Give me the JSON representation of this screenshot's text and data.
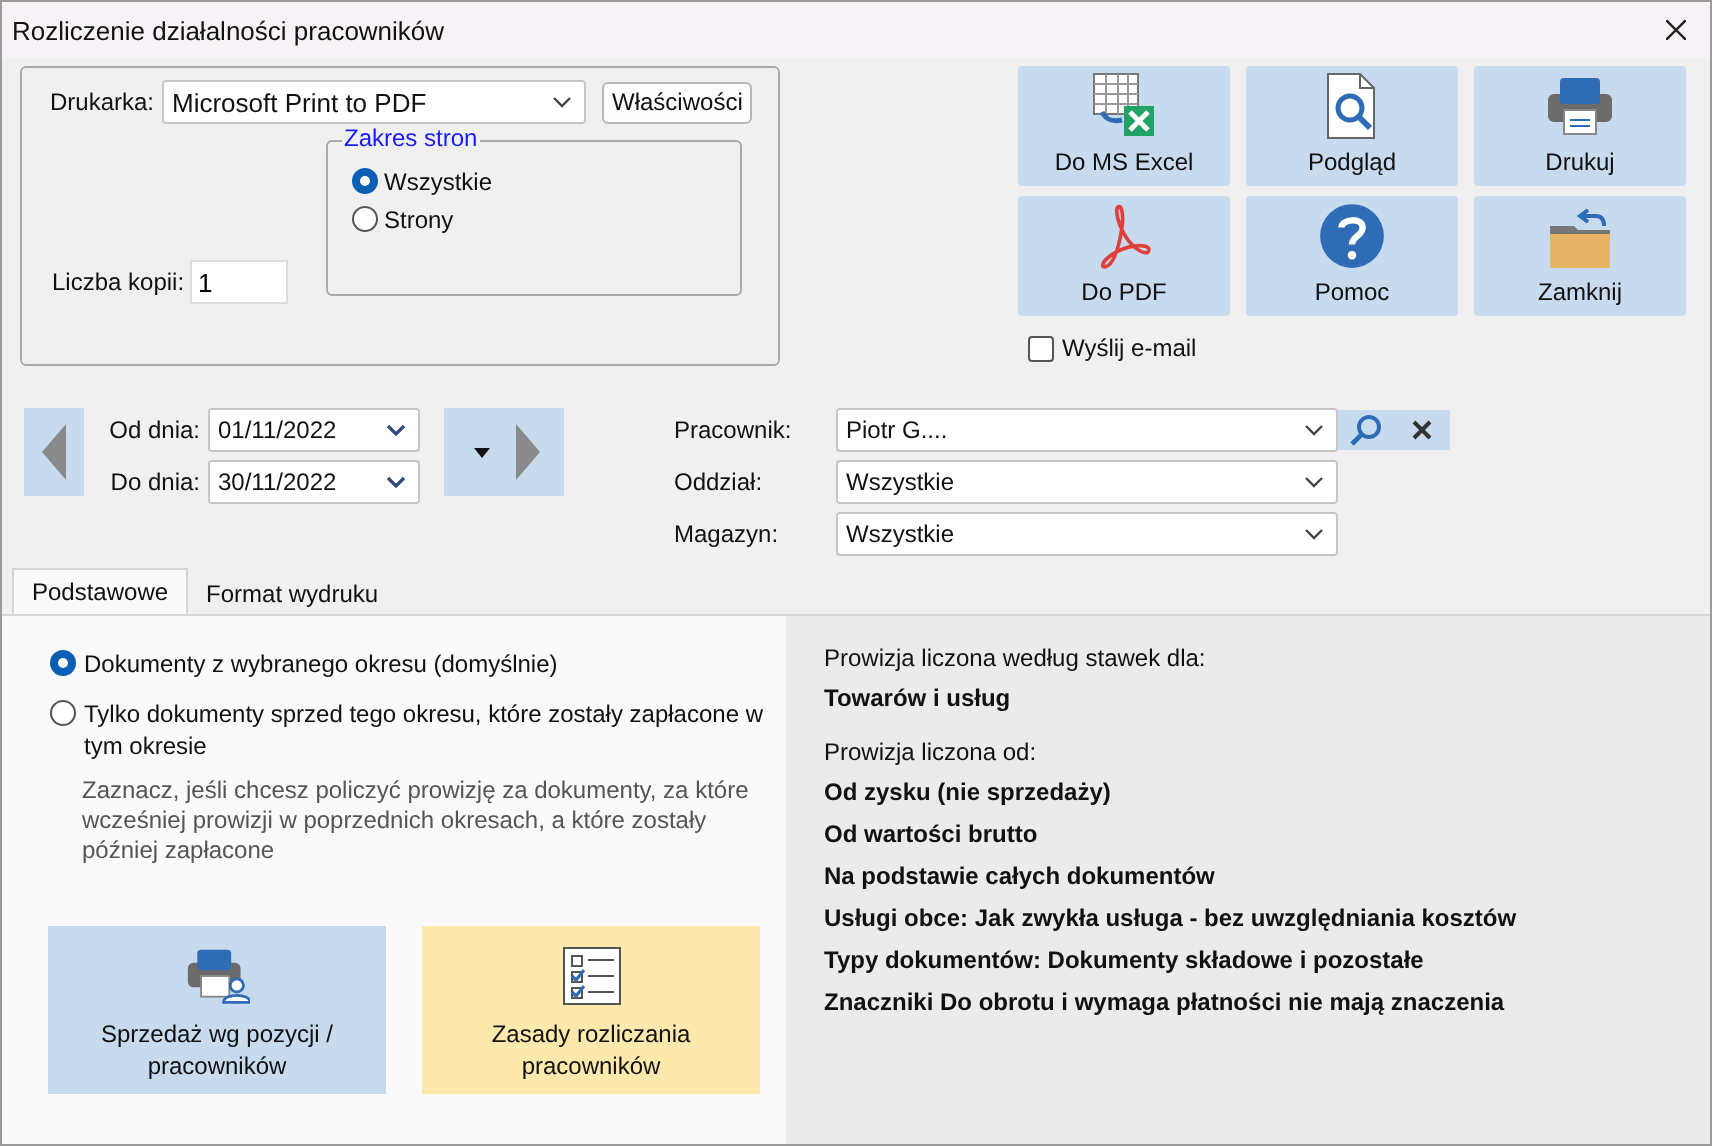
{
  "window": {
    "title": "Rozliczenie działalności pracowników"
  },
  "printer": {
    "label": "Drukarka:",
    "value": "Microsoft Print to PDF",
    "properties_button": "Właściwości",
    "copies_label": "Liczba kopii:",
    "copies": "1",
    "page_range": {
      "title": "Zakres stron",
      "options": [
        {
          "label": "Wszystkie",
          "selected": true
        },
        {
          "label": "Strony",
          "selected": false
        }
      ]
    }
  },
  "actions": [
    {
      "label": "Do MS Excel",
      "kind": "excel"
    },
    {
      "label": "Podgląd",
      "kind": "preview"
    },
    {
      "label": "Drukuj",
      "kind": "print"
    },
    {
      "label": "Do PDF",
      "kind": "pdf"
    },
    {
      "label": "Pomoc",
      "kind": "help"
    },
    {
      "label": "Zamknij",
      "kind": "close"
    }
  ],
  "send_email": {
    "label": "Wyślij e-mail",
    "checked": false
  },
  "period": {
    "from_label": "Od dnia:",
    "from": "01/11/2022",
    "to_label": "Do dnia:",
    "to": "30/11/2022"
  },
  "filters": [
    {
      "label": "Pracownik:",
      "value": "Piotr G....",
      "kind": "search"
    },
    {
      "label": "Oddział:",
      "value": "Wszystkie",
      "kind": "plain"
    },
    {
      "label": "Magazyn:",
      "value": "Wszystkie",
      "kind": "plain"
    }
  ],
  "tabs": [
    {
      "label": "Podstawowe",
      "selected": true
    },
    {
      "label": "Format wydruku",
      "selected": false
    }
  ],
  "document_options": [
    {
      "label": "Dokumenty z wybranego okresu (domyślnie)",
      "selected": true
    },
    {
      "label": "Tylko dokumenty sprzed tego okresu, które zostały zapłacone w tym okresie",
      "selected": false,
      "hint": "Zaznacz, jeśli chcesz policzyć prowizję za dokumenty, za które wcześniej prowizji w poprzednich okresach, a które zostały później zapłacone"
    }
  ],
  "reports": [
    {
      "label": "Sprzedaż wg pozycji / pracowników",
      "kind": "sales"
    },
    {
      "label": "Zasady rozliczania pracowników",
      "kind": "rules"
    }
  ],
  "summary": {
    "rates_heading": "Prowizja liczona według stawek dla:",
    "rates": [
      "Towarów i usług"
    ],
    "basis_heading": "Prowizja liczona od:",
    "basis": [
      "Od zysku (nie sprzedaży)",
      "Od wartości brutto",
      "Na podstawie całych dokumentów",
      "Usługi obce: Jak zwykła usługa - bez uwzględniania kosztów",
      "Typy dokumentów: Dokumenty składowe i pozostałe",
      "Znaczniki Do obrotu i wymaga płatności nie mają znaczenia"
    ]
  }
}
